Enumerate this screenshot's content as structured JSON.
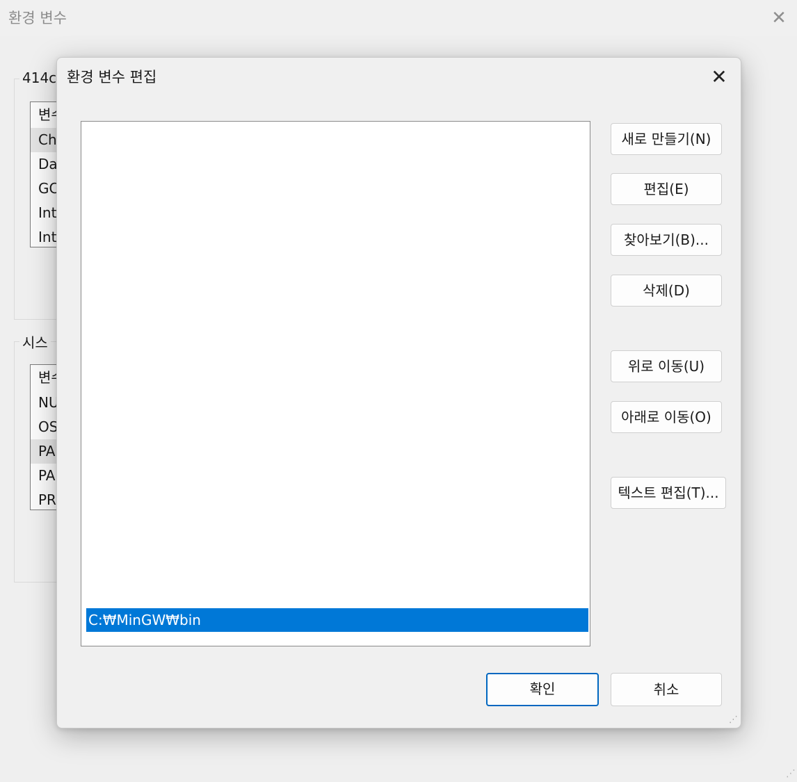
{
  "background_window": {
    "title": "환경 변수",
    "user_group_label": "414c",
    "user_list": {
      "header": "변수",
      "rows": [
        "Ch",
        "Da",
        "GC",
        "Int",
        "Int"
      ],
      "selected_index": 0
    },
    "system_group_label": "시스",
    "system_list": {
      "header": "변수",
      "rows": [
        "NU",
        "OS",
        "PA",
        "PA",
        "PR"
      ],
      "selected_index": 2
    }
  },
  "dialog": {
    "title": "환경 변수 편집",
    "path_entries": [
      "C:₩MinGW₩bin"
    ],
    "selected_entry": 0,
    "buttons": {
      "new": "새로 만들기(N)",
      "edit": "편집(E)",
      "browse": "찾아보기(B)...",
      "delete": "삭제(D)",
      "move_up": "위로 이동(U)",
      "move_down": "아래로 이동(O)",
      "edit_text": "텍스트 편집(T)...",
      "ok": "확인",
      "cancel": "취소"
    }
  },
  "icons": {
    "close": "close-icon",
    "resize": "resize-grip-icon"
  },
  "colors": {
    "selection": "#0078d7",
    "primary_border": "#0067c0"
  }
}
